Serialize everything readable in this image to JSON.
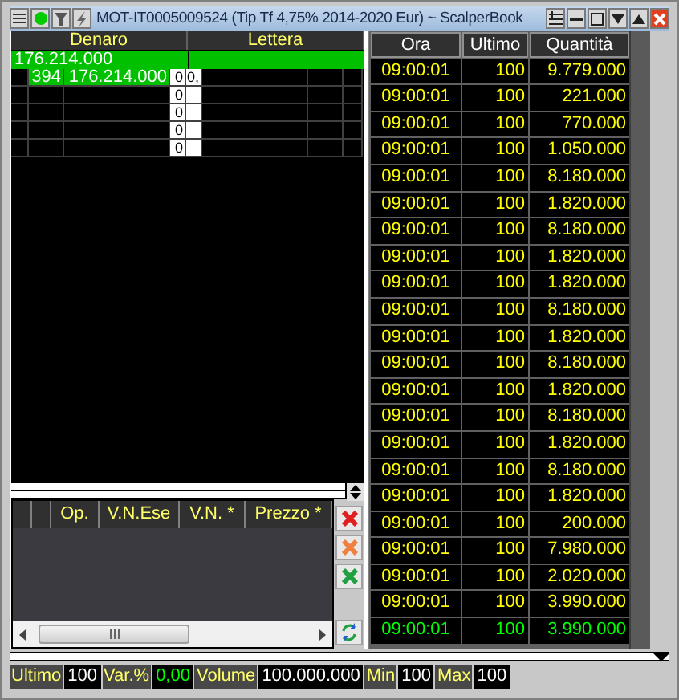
{
  "window": {
    "title": "MOT-IT0005009524 (Tip Tf 4,75% 2014-2020 Eur) ~ ScalperBook"
  },
  "book": {
    "columns": [
      "Denaro",
      "Lettera"
    ],
    "best_bid": "176.214.000",
    "levels": [
      {
        "count": "394",
        "quantity": "176.214.000",
        "column_3": "0",
        "column_4": "0,"
      },
      {
        "column_3": "0"
      },
      {
        "column_3": "0"
      },
      {
        "column_3": "0"
      },
      {
        "column_3": "0"
      }
    ]
  },
  "orders": {
    "columns": [
      "Op.",
      "V.N.Ese",
      "V.N. *",
      "Prezzo *"
    ]
  },
  "trades": {
    "columns": [
      "Ora",
      "Ultimo",
      "Quantità"
    ],
    "rows": [
      {
        "time": "09:00:01",
        "price": "100",
        "quantity": "9.779.000",
        "highlighted": false
      },
      {
        "time": "09:00:01",
        "price": "100",
        "quantity": "221.000",
        "highlighted": false
      },
      {
        "time": "09:00:01",
        "price": "100",
        "quantity": "770.000",
        "highlighted": false
      },
      {
        "time": "09:00:01",
        "price": "100",
        "quantity": "1.050.000",
        "highlighted": false
      },
      {
        "time": "09:00:01",
        "price": "100",
        "quantity": "8.180.000",
        "highlighted": false
      },
      {
        "time": "09:00:01",
        "price": "100",
        "quantity": "1.820.000",
        "highlighted": false
      },
      {
        "time": "09:00:01",
        "price": "100",
        "quantity": "8.180.000",
        "highlighted": false
      },
      {
        "time": "09:00:01",
        "price": "100",
        "quantity": "1.820.000",
        "highlighted": false
      },
      {
        "time": "09:00:01",
        "price": "100",
        "quantity": "1.820.000",
        "highlighted": false
      },
      {
        "time": "09:00:01",
        "price": "100",
        "quantity": "8.180.000",
        "highlighted": false
      },
      {
        "time": "09:00:01",
        "price": "100",
        "quantity": "1.820.000",
        "highlighted": false
      },
      {
        "time": "09:00:01",
        "price": "100",
        "quantity": "8.180.000",
        "highlighted": false
      },
      {
        "time": "09:00:01",
        "price": "100",
        "quantity": "1.820.000",
        "highlighted": false
      },
      {
        "time": "09:00:01",
        "price": "100",
        "quantity": "8.180.000",
        "highlighted": false
      },
      {
        "time": "09:00:01",
        "price": "100",
        "quantity": "1.820.000",
        "highlighted": false
      },
      {
        "time": "09:00:01",
        "price": "100",
        "quantity": "8.180.000",
        "highlighted": false
      },
      {
        "time": "09:00:01",
        "price": "100",
        "quantity": "1.820.000",
        "highlighted": false
      },
      {
        "time": "09:00:01",
        "price": "100",
        "quantity": "200.000",
        "highlighted": false
      },
      {
        "time": "09:00:01",
        "price": "100",
        "quantity": "7.980.000",
        "highlighted": false
      },
      {
        "time": "09:00:01",
        "price": "100",
        "quantity": "2.020.000",
        "highlighted": false
      },
      {
        "time": "09:00:01",
        "price": "100",
        "quantity": "3.990.000",
        "highlighted": false
      },
      {
        "time": "09:00:01",
        "price": "100",
        "quantity": "3.990.000",
        "highlighted": true
      }
    ]
  },
  "status_bar": [
    {
      "label": "Ultimo",
      "value": "100",
      "highlighted": false
    },
    {
      "label": "Var.%",
      "value": "0,00",
      "highlighted": true
    },
    {
      "label": "Volume",
      "value": "100.000.000",
      "highlighted": false
    },
    {
      "label": "Min",
      "value": "100",
      "highlighted": false
    },
    {
      "label": "Max",
      "value": "100",
      "highlighted": false
    }
  ]
}
